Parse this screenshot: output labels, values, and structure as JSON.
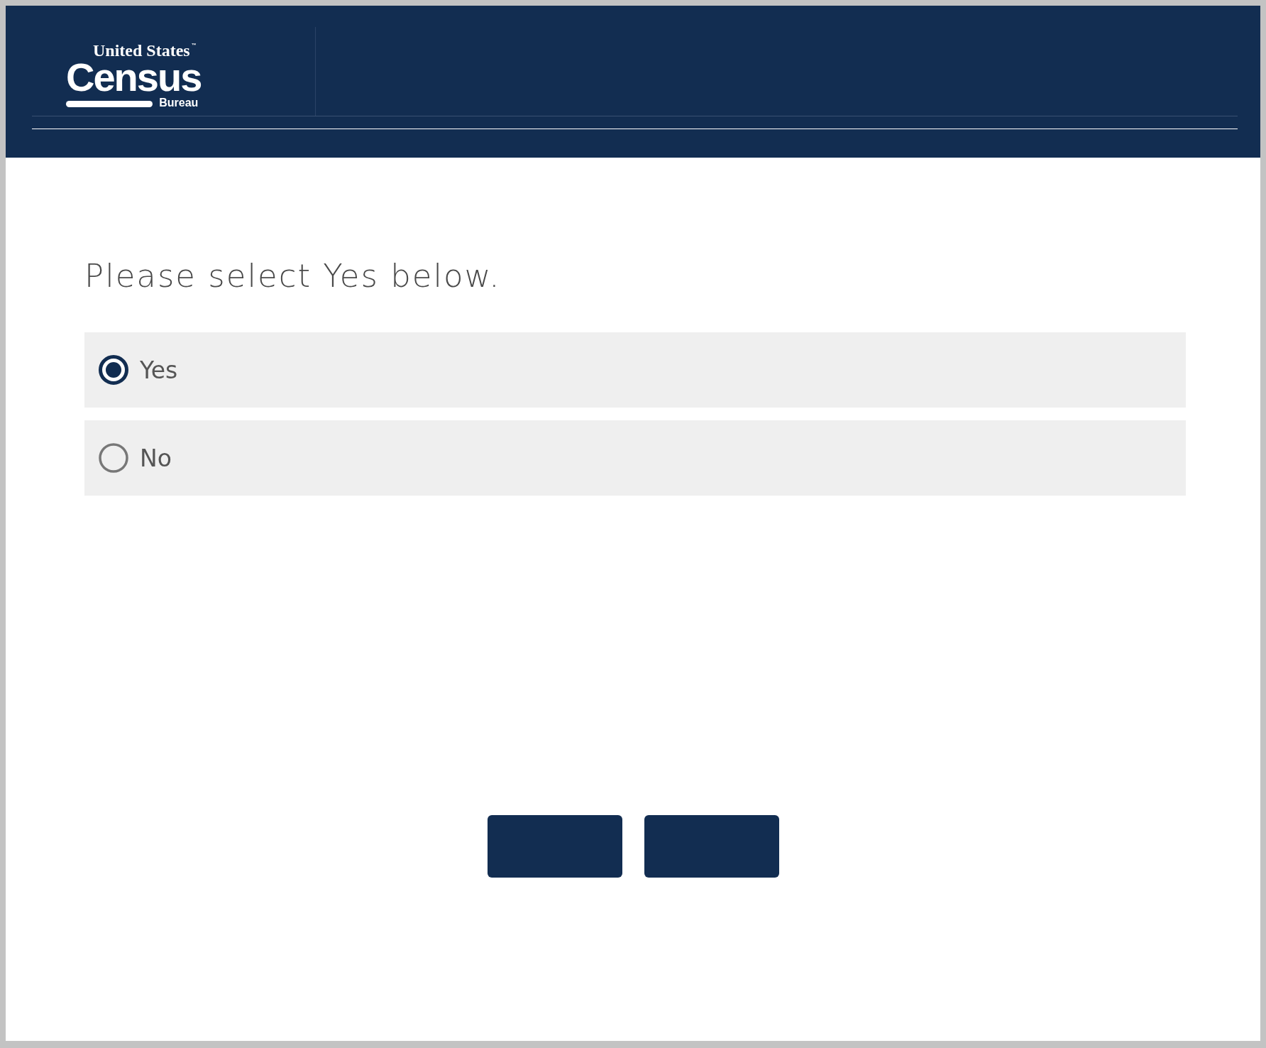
{
  "header": {
    "logo": {
      "top_line": "United States",
      "trademark": "™",
      "main_word": "Census",
      "bottom_word": "Bureau"
    }
  },
  "question": {
    "prompt": "Please select Yes below.",
    "options": [
      {
        "label": "Yes",
        "selected": true
      },
      {
        "label": "No",
        "selected": false
      }
    ]
  },
  "buttons": [
    {
      "kind": "primary"
    },
    {
      "kind": "primary"
    }
  ]
}
